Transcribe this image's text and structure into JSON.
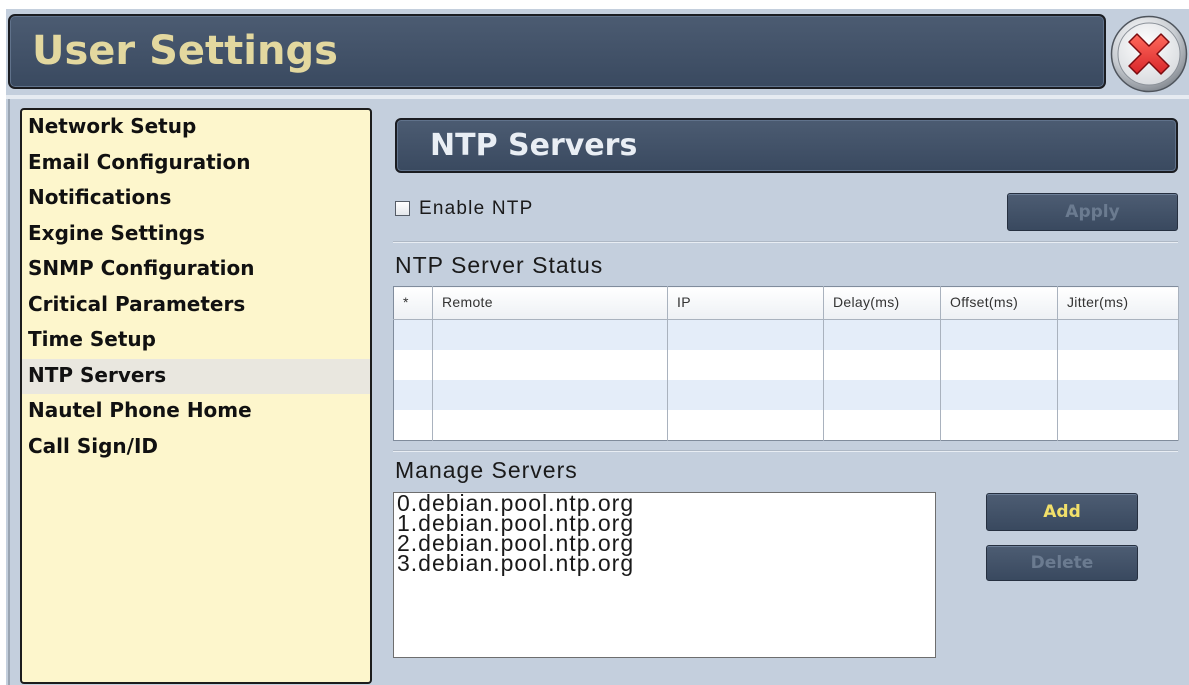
{
  "window": {
    "title": "User Settings",
    "close_icon": "close-icon"
  },
  "sidebar": {
    "items": [
      {
        "label": "Network Setup",
        "selected": false
      },
      {
        "label": "Email Configuration",
        "selected": false
      },
      {
        "label": "Notifications",
        "selected": false
      },
      {
        "label": "Exgine Settings",
        "selected": false
      },
      {
        "label": "SNMP Configuration",
        "selected": false
      },
      {
        "label": "Critical Parameters",
        "selected": false
      },
      {
        "label": "Time Setup",
        "selected": false
      },
      {
        "label": "NTP Servers",
        "selected": true
      },
      {
        "label": "Nautel Phone Home",
        "selected": false
      },
      {
        "label": "Call Sign/ID",
        "selected": false
      }
    ]
  },
  "panel": {
    "title": "NTP Servers",
    "enable_ntp": {
      "label": "Enable NTP",
      "checked": false
    },
    "apply": {
      "label": "Apply",
      "disabled": true
    },
    "status": {
      "title": "NTP Server Status",
      "columns": [
        "*",
        "Remote",
        "IP",
        "Delay(ms)",
        "Offset(ms)",
        "Jitter(ms)"
      ],
      "rows": []
    },
    "manage": {
      "title": "Manage Servers",
      "servers": [
        "0.debian.pool.ntp.org",
        "1.debian.pool.ntp.org",
        "2.debian.pool.ntp.org",
        "3.debian.pool.ntp.org"
      ],
      "add": {
        "label": "Add",
        "disabled": false
      },
      "delete": {
        "label": "Delete",
        "disabled": true
      }
    }
  },
  "colors": {
    "title_text": "#e3d89f",
    "panel_title_text": "#e9eef4",
    "header_bg": "#3e4f67",
    "button_bg": "#3e4f67",
    "sidebar_bg": "#fdf6cc",
    "sidebar_selected_bg": "#e9e7df",
    "panel_bg": "#c4cfdd",
    "add_text": "#f2e06a",
    "disabled_text": "#6b7b90",
    "close_red": "#d8262a"
  }
}
